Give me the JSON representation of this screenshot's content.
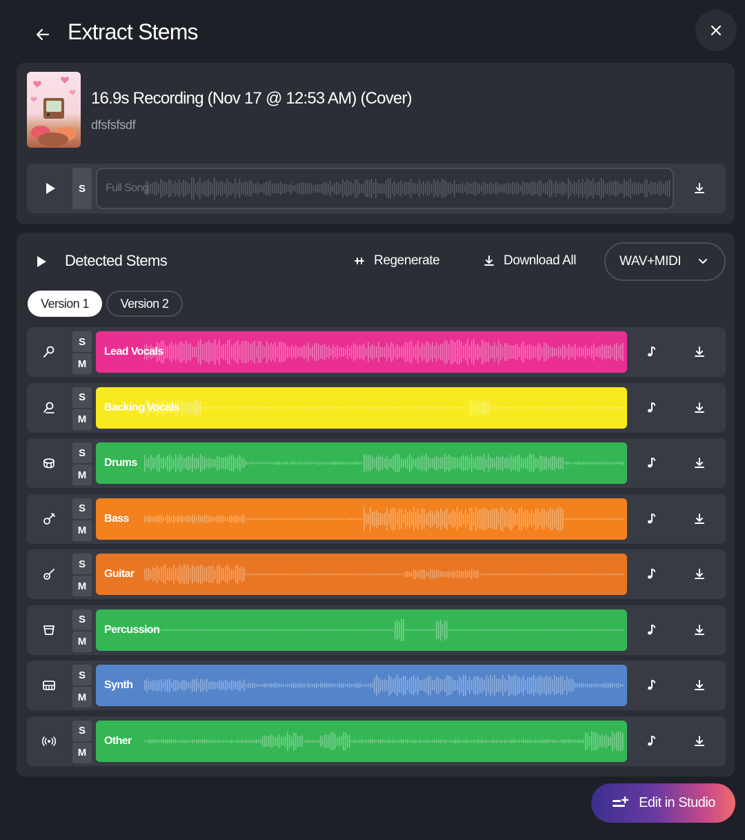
{
  "header": {
    "title": "Extract Stems"
  },
  "song": {
    "title": "16.9s Recording (Nov 17 @ 12:53 AM) (Cover)",
    "subtitle": "dfsfsfsdf",
    "full_label": "Full Song",
    "solo_label": "S"
  },
  "stems_section": {
    "title": "Detected Stems",
    "regenerate_label": "Regenerate",
    "download_all_label": "Download All",
    "format_value": "WAV+MIDI",
    "versions": [
      "Version 1",
      "Version 2"
    ],
    "active_version": "Version 1",
    "solo_label": "S",
    "mute_label": "M"
  },
  "stems": [
    {
      "name": "Lead Vocals",
      "color": "#e92f92",
      "icon": "microphone-icon"
    },
    {
      "name": "Backing Vocals",
      "color": "#f7ea1f",
      "icon": "users-mic-icon"
    },
    {
      "name": "Drums",
      "color": "#34b654",
      "icon": "drum-icon"
    },
    {
      "name": "Bass",
      "color": "#f2811e",
      "icon": "bass-guitar-icon"
    },
    {
      "name": "Guitar",
      "color": "#e97622",
      "icon": "guitar-icon"
    },
    {
      "name": "Percussion",
      "color": "#34b654",
      "icon": "bongo-icon"
    },
    {
      "name": "Synth",
      "color": "#5485cb",
      "icon": "keyboard-icon"
    },
    {
      "name": "Other",
      "color": "#34b654",
      "icon": "broadcast-icon"
    }
  ],
  "footer": {
    "edit_label": "Edit in Studio"
  }
}
